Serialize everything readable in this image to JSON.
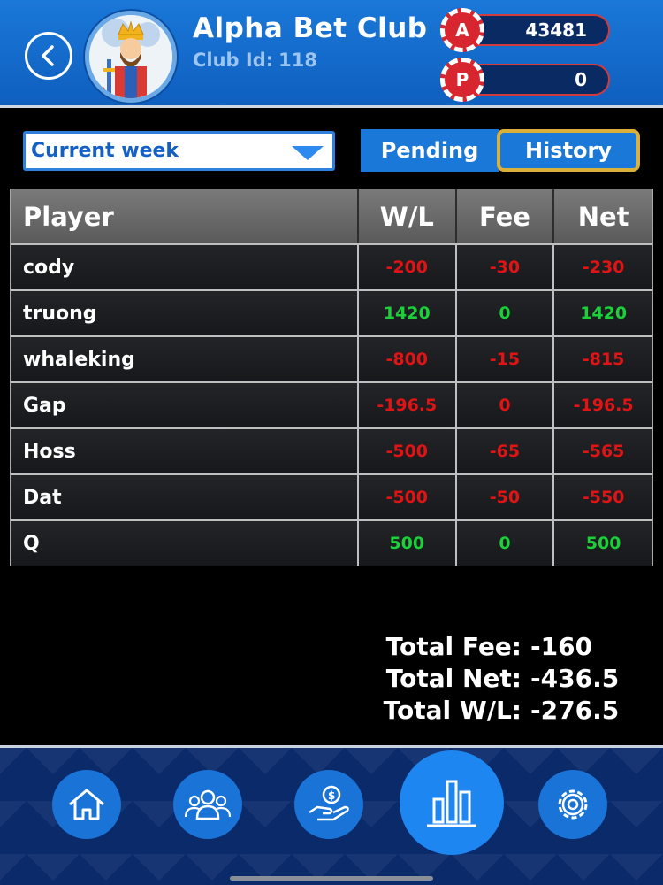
{
  "header": {
    "club_name": "Alpha Bet Club",
    "club_id_label": "Club Id:",
    "club_id": "118",
    "balances": [
      {
        "chip": "A",
        "value": "43481"
      },
      {
        "chip": "P",
        "value": "0"
      }
    ]
  },
  "filters": {
    "period_selected": "Current week",
    "tabs": [
      {
        "label": "Pending",
        "active": false
      },
      {
        "label": "History",
        "active": true
      }
    ]
  },
  "table": {
    "columns": [
      "Player",
      "W/L",
      "Fee",
      "Net"
    ],
    "rows": [
      {
        "player": "cody",
        "wl": "-200",
        "fee": "-30",
        "net": "-230"
      },
      {
        "player": "truong",
        "wl": "1420",
        "fee": "0",
        "net": "1420"
      },
      {
        "player": "whaleking",
        "wl": "-800",
        "fee": "-15",
        "net": "-815"
      },
      {
        "player": "Gap",
        "wl": "-196.5",
        "fee": "0",
        "net": "-196.5"
      },
      {
        "player": "Hoss",
        "wl": "-500",
        "fee": "-65",
        "net": "-565"
      },
      {
        "player": "Dat",
        "wl": "-500",
        "fee": "-50",
        "net": "-550"
      },
      {
        "player": "Q",
        "wl": "500",
        "fee": "0",
        "net": "500"
      }
    ]
  },
  "totals": {
    "fee_label": "Total Fee:",
    "fee": "-160",
    "net_label": "Total Net:",
    "net": "-436.5",
    "wl_label": "Total W/L:",
    "wl": "-276.5"
  },
  "nav": {
    "items": [
      "home-icon",
      "members-icon",
      "cashier-icon",
      "stats-icon",
      "settings-icon"
    ],
    "active": "stats-icon"
  },
  "colors": {
    "header_blue": "#1a78d8",
    "negative": "#e01414",
    "positive": "#1cd03a",
    "tab_highlight": "#d8b03a"
  }
}
